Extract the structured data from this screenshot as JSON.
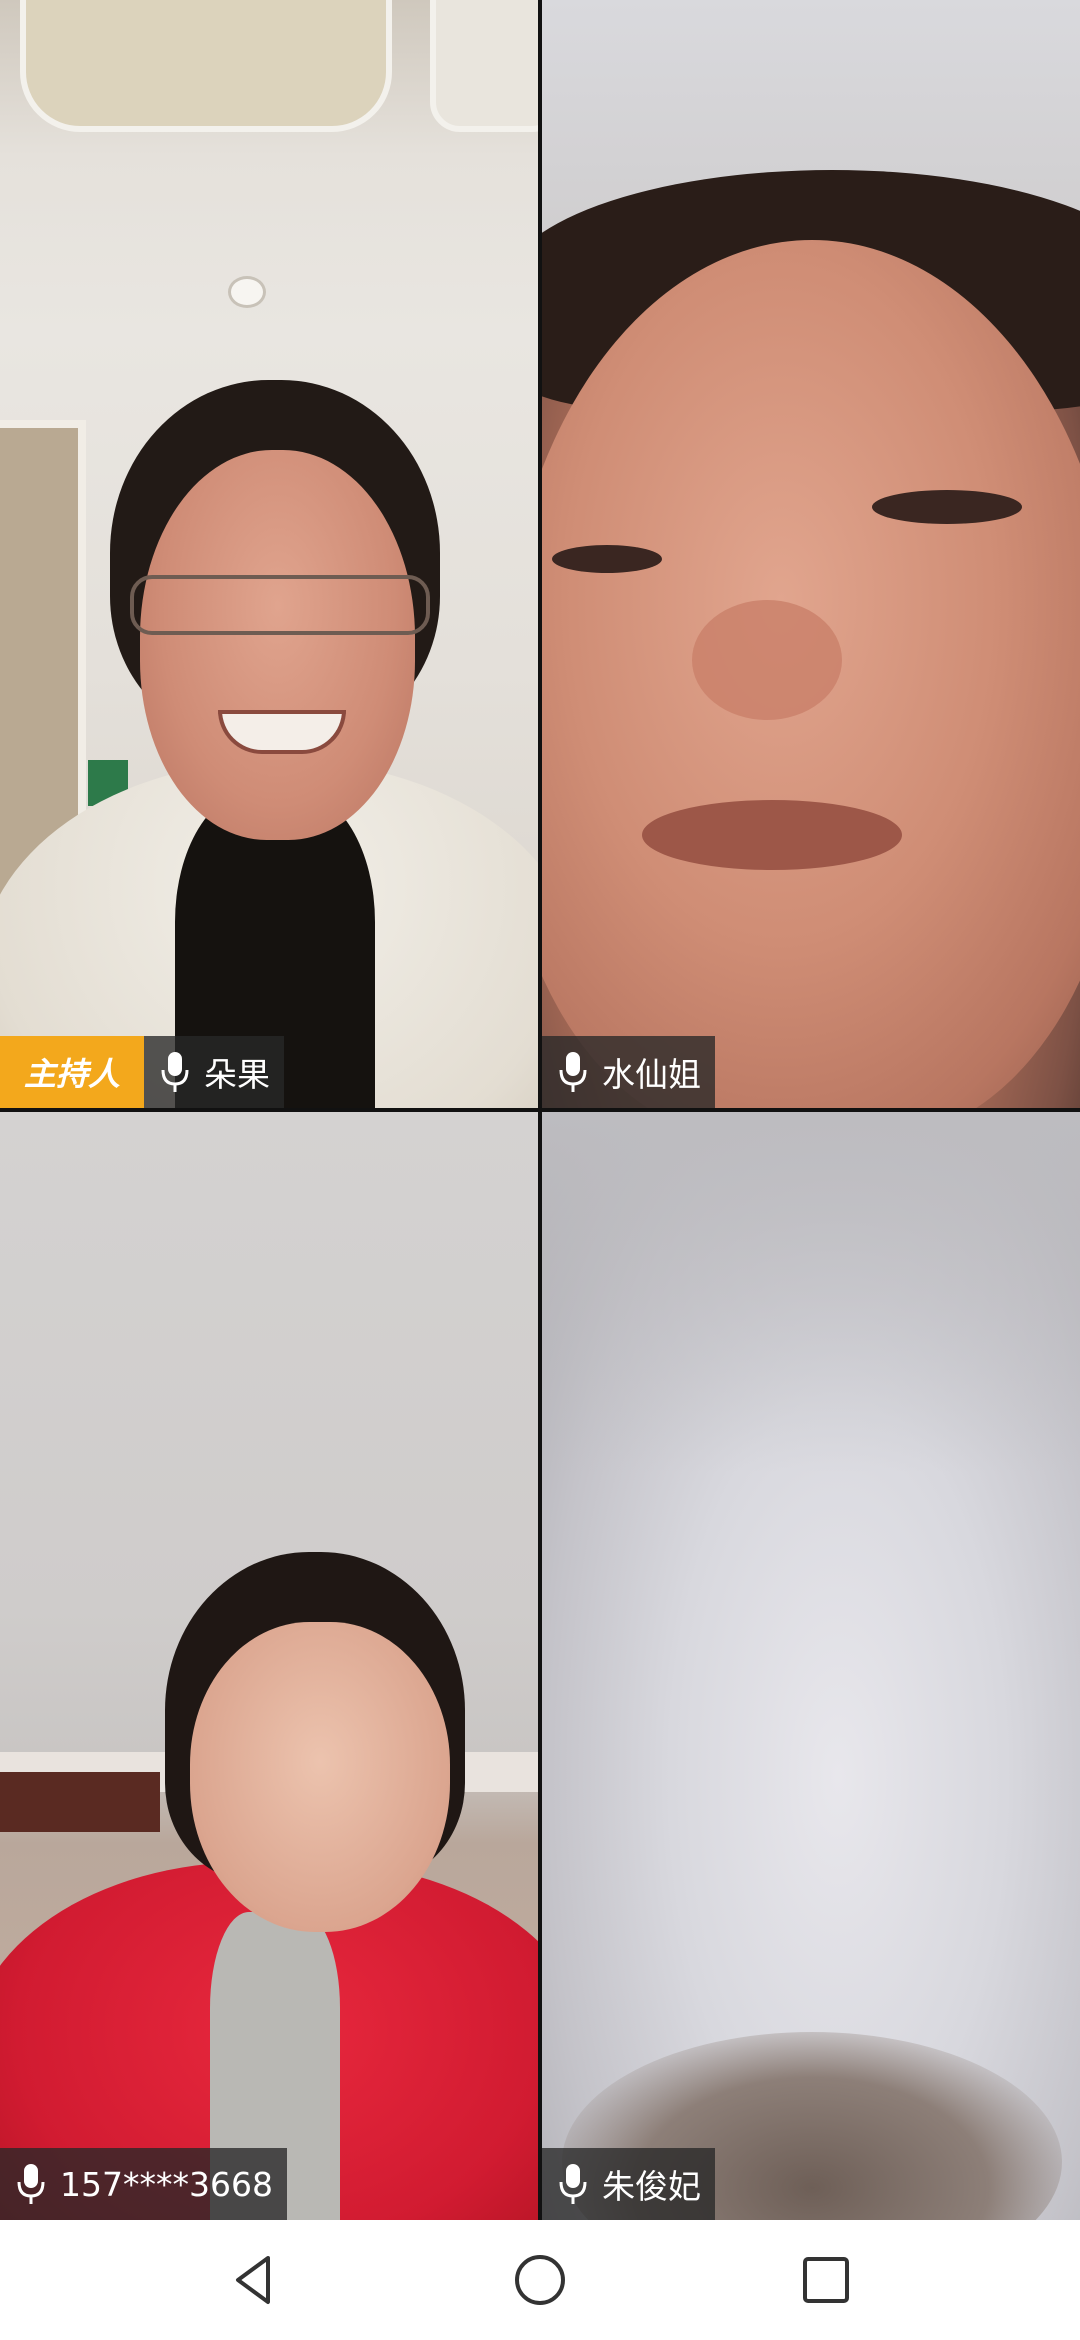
{
  "participants": [
    {
      "name": "朵果",
      "host_badge": "主持人",
      "is_host": true,
      "mic_icon": "microphone-icon"
    },
    {
      "name": "水仙姐",
      "is_host": false,
      "mic_icon": "microphone-icon"
    },
    {
      "name": "157****3668",
      "is_host": false,
      "mic_icon": "microphone-icon"
    },
    {
      "name": "朱俊妃",
      "is_host": false,
      "mic_icon": "microphone-icon"
    }
  ],
  "colors": {
    "host_badge_bg": "#f3a81c",
    "label_bg": "#282828",
    "divider": "#111111",
    "navbar_bg": "#ffffff",
    "nav_icon": "#333333"
  },
  "navbar": {
    "buttons": [
      "back-icon",
      "home-icon",
      "recents-icon"
    ]
  }
}
